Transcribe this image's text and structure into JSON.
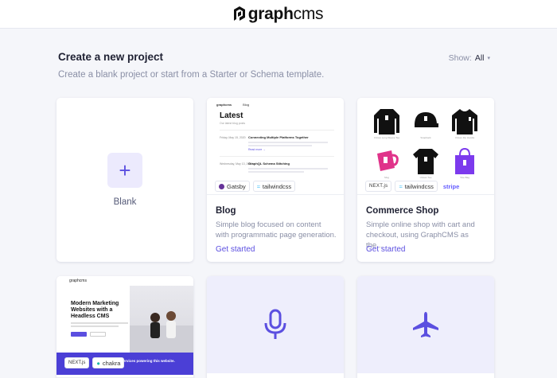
{
  "header": {
    "logo_bold": "graph",
    "logo_light": "cms"
  },
  "page": {
    "title": "Create a new project",
    "subtitle": "Create a blank project or start from a Starter or Schema template.",
    "show_label": "Show:",
    "show_value": "All"
  },
  "cards": {
    "blank": {
      "label": "Blank"
    },
    "blog": {
      "title": "Blog",
      "description": "Simple blog focused on content with programmatic page generation.",
      "cta": "Get started",
      "badges": [
        "Gatsby",
        "tailwindcss"
      ],
      "preview": {
        "nav_brand": "graphcms",
        "nav_link": "Blog",
        "heading": "Latest",
        "subheading": "Our latest blog posts",
        "posts": [
          {
            "date": "Friday, May 15, 2020",
            "title": "Connecting Multiple Platforms Together",
            "more": "Read more →"
          },
          {
            "date": "Wednesday, May 13, 2020",
            "title": "GraphQL Schema Stitching",
            "more": "Read more →"
          }
        ]
      }
    },
    "commerce": {
      "title": "Commerce Shop",
      "description": "Simple online shop with cart and checkout, using GraphCMS as the...",
      "cta": "Get started",
      "badges": [
        "NEXT.js",
        "tailwindcss",
        "stripe"
      ],
      "products": [
        "Unisex Long Sleeve Tee",
        "Snapback",
        "Unisex Zip Hoodie",
        "Mug",
        "Unisex Tee",
        "Tote Bag"
      ]
    },
    "marketing": {
      "nav_brand": "graphcms",
      "headline": "Modern Marketing Websites with a Headless CMS",
      "band_text": "Here are the services powering this website.",
      "badges": [
        "NEXT.js",
        "chakra"
      ]
    },
    "podcast": {
      "icon": "microphone-icon"
    },
    "travel": {
      "icon": "airplane-icon"
    }
  },
  "colors": {
    "accent": "#5b4fe0",
    "icon_bg": "#eeeefc"
  }
}
